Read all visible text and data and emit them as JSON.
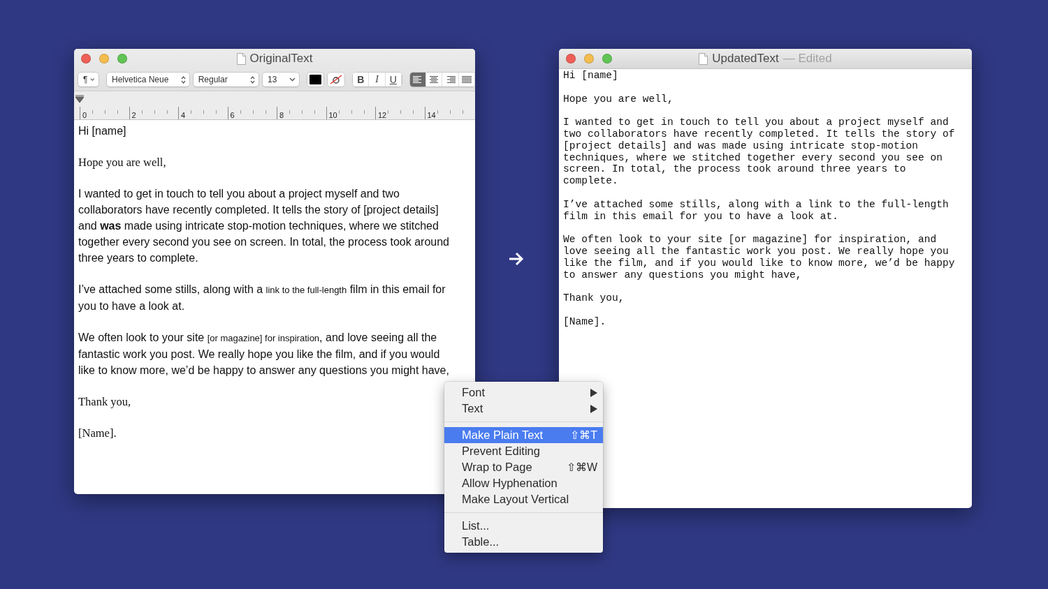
{
  "original_window": {
    "title": "OriginalText",
    "toolbar": {
      "paragraph": "¶",
      "font": "Helvetica Neue",
      "style": "Regular",
      "size": "13",
      "bold": "B",
      "italic": "I",
      "underline": "U",
      "alignments": [
        {
          "kind": "left",
          "selected": true
        },
        {
          "kind": "center",
          "selected": false
        },
        {
          "kind": "right",
          "selected": false
        },
        {
          "kind": "justify",
          "selected": false
        }
      ]
    },
    "ruler": {
      "labels": [
        "0",
        "2",
        "4",
        "6",
        "8",
        "10",
        "12",
        "14"
      ]
    },
    "paragraphs": [
      {
        "kind": "sans",
        "runs": [
          {
            "text": "Hi [name]",
            "kind": "normal"
          }
        ]
      },
      {
        "kind": "serif",
        "runs": [
          {
            "text": "Hope you are well,",
            "kind": "normal"
          }
        ]
      },
      {
        "kind": "sans",
        "runs": [
          {
            "text": "I wanted to get in touch to tell you about a project myself and two collaborators have recently completed. It tells the story of [project details] and **was** made using intricate stop-motion techniques, where we stitched together every second you see on screen. In total, the process took around three years to complete.",
            "kind": "normal"
          }
        ]
      },
      {
        "kind": "sans",
        "runs": [
          {
            "text": "I’ve attached some stills, along with a ",
            "kind": "normal"
          },
          {
            "text": "link to the full-length",
            "kind": "small"
          },
          {
            "text": " film in this email for you to have a look at.",
            "kind": "normal"
          }
        ]
      },
      {
        "kind": "sans",
        "runs": [
          {
            "text": "We often look to your site ",
            "kind": "normal"
          },
          {
            "text": "[or magazine] for inspiration",
            "kind": "small"
          },
          {
            "text": ", and love seeing all the fantastic work you post. We really hope you like the film, and if you would like to know more, we’d be happy to answer any questions you might have,",
            "kind": "normal"
          }
        ]
      },
      {
        "kind": "serif",
        "runs": [
          {
            "text": "Thank you,",
            "kind": "normal"
          }
        ]
      },
      {
        "kind": "serif",
        "runs": [
          {
            "text": "[Name].",
            "kind": "normal"
          }
        ]
      }
    ]
  },
  "updated_window": {
    "title": "UpdatedText",
    "status": "— Edited",
    "paragraphs": [
      "Hi [name]",
      "Hope you are well,",
      "I wanted to get in touch to tell you about a project myself and two collaborators have recently completed. It tells the story of [project details] and was made using intricate stop-motion techniques, where we stitched together every second you see on screen. In total, the process took around three years to complete.",
      "I’ve attached some stills, along with a link to the full-length film in this email for you to have a look at.",
      "We often look to your site [or magazine] for inspiration, and love seeing all the fantastic work you post. We really hope you like the film, and if you would like to know more, we’d be happy to answer any questions you might have,",
      "Thank you,",
      "[Name]."
    ]
  },
  "context_menu": {
    "groups": [
      [
        {
          "label": "Font",
          "submenu": true,
          "selected": false
        },
        {
          "label": "Text",
          "submenu": true,
          "selected": false
        }
      ],
      [
        {
          "label": "Make Plain Text",
          "shortcut": "⇧⌘T",
          "submenu": false,
          "selected": true
        },
        {
          "label": "Prevent Editing",
          "submenu": false,
          "selected": false
        },
        {
          "label": "Wrap to Page",
          "shortcut": "⇧⌘W",
          "submenu": false,
          "selected": false
        },
        {
          "label": "Allow Hyphenation",
          "submenu": false,
          "selected": false
        },
        {
          "label": "Make Layout Vertical",
          "submenu": false,
          "selected": false
        }
      ],
      [
        {
          "label": "List...",
          "submenu": false,
          "selected": false
        },
        {
          "label": "Table...",
          "submenu": false,
          "selected": false
        }
      ]
    ]
  }
}
